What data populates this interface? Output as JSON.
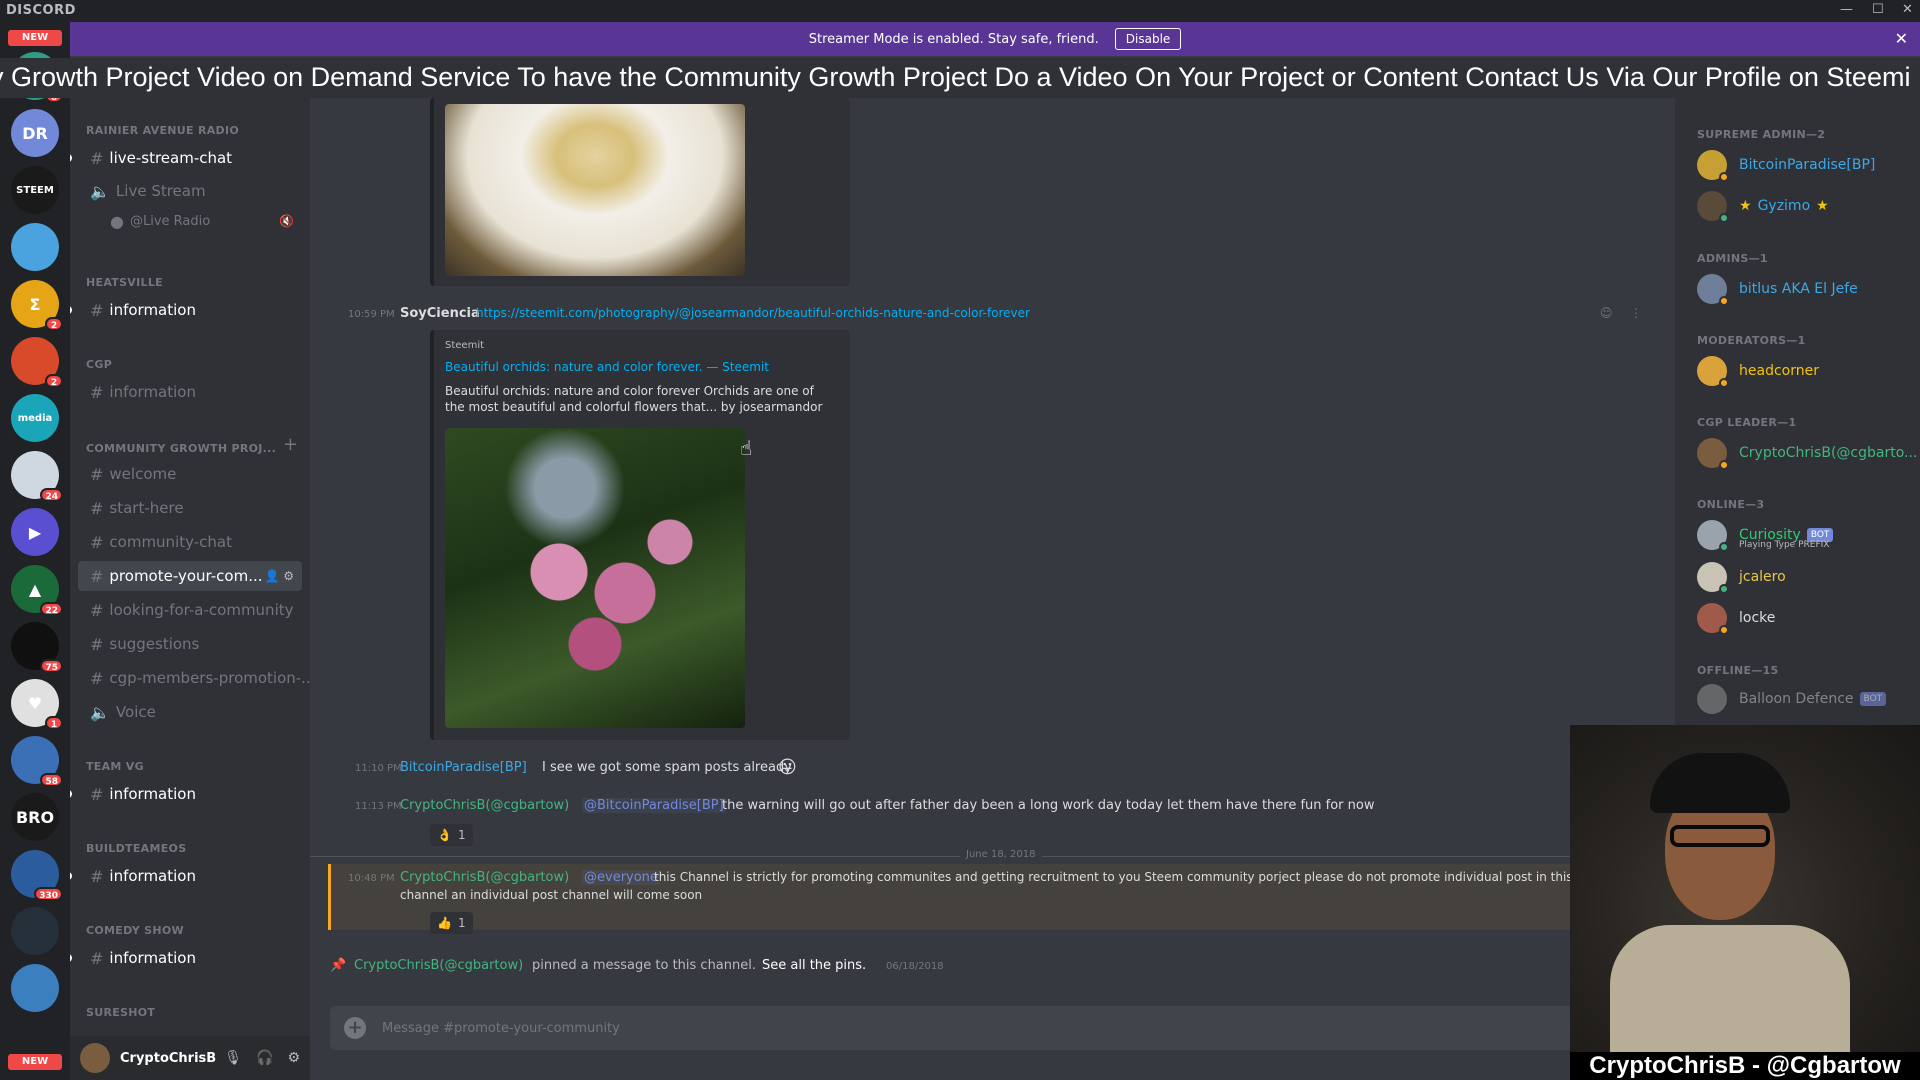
{
  "app": {
    "brand": "DISCORD"
  },
  "banner": {
    "text": "Streamer Mode is enabled. Stay safe, friend.",
    "button": "Disable"
  },
  "ticker": {
    "text": "y Growth Project Video on Demand Service To have the Community Growth Project Do a Video On Your Project or Content Contact Us Via Our Profile on Steemi"
  },
  "servers": {
    "new_top": "NEW",
    "new_bottom": "NEW",
    "items": [
      {
        "label": "",
        "color": "#2c9e84",
        "badge": "6"
      },
      {
        "label": "DR",
        "color": "#7289da",
        "badge": ""
      },
      {
        "label": "STEEM",
        "color": "#1a1a1a",
        "badge": ""
      },
      {
        "label": "",
        "color": "#4aa3df",
        "badge": ""
      },
      {
        "label": "Σ",
        "color": "#e6a417",
        "badge": "2"
      },
      {
        "label": "",
        "color": "#d84a2a",
        "badge": "2"
      },
      {
        "label": "media",
        "color": "#1aa5b8",
        "badge": ""
      },
      {
        "label": "",
        "color": "#cfd8e0",
        "badge": "24"
      },
      {
        "label": "▶",
        "color": "#5b4fd1",
        "badge": ""
      },
      {
        "label": "▲",
        "color": "#1b6b3a",
        "badge": "22"
      },
      {
        "label": "",
        "color": "#101010",
        "badge": "75"
      },
      {
        "label": "♥",
        "color": "#e0e0e0",
        "badge": "1"
      },
      {
        "label": "",
        "color": "#3b6fb6",
        "badge": "58"
      },
      {
        "label": "BRO",
        "color": "#1a1a1a",
        "badge": ""
      },
      {
        "label": "",
        "color": "#2b5d9e",
        "badge": "330"
      },
      {
        "label": "",
        "color": "#26303a",
        "badge": ""
      },
      {
        "label": "",
        "color": "#3b7fbf",
        "badge": ""
      }
    ]
  },
  "channels": {
    "categories": {
      "rainier": "RAINIER AVENUE RADIO",
      "heatsville": "HEATSVILLE",
      "cgp": "CGP",
      "cgp_project": "COMMUNITY GROWTH PROJ...",
      "team_vg": "TEAM VG",
      "buildteam": "BUILDTEAMEOS",
      "comedy": "COMEDY SHOW",
      "sureshot": "SURESHOT"
    },
    "live_stream_chat": "live-stream-chat",
    "live_stream_voice": "Live Stream",
    "live_radio_user": "@Live Radio",
    "heatsville_info": "information",
    "cgp_info": "information",
    "welcome": "welcome",
    "start_here": "start-here",
    "community_chat": "community-chat",
    "promote": "promote-your-com...",
    "looking": "looking-for-a-community",
    "suggestions": "suggestions",
    "cgp_members": "cgp-members-promotion-...",
    "voice": "Voice",
    "teamvg_info": "information",
    "buildteam_info": "information",
    "comedy_info": "information"
  },
  "user_panel": {
    "name": "CryptoChrisB"
  },
  "messages": {
    "m1": {
      "time": "10:59 PM",
      "author": "SoyCiencia",
      "link": "https://steemit.com/photography/@josearmandor/beautiful-orchids-nature-and-color-forever",
      "embed_provider": "Steemit",
      "embed_title": "Beautiful orchids: nature and color forever. — Steemit",
      "embed_desc_1": "Beautiful orchids: nature and color forever      Orchids are one of",
      "embed_desc_2": "the most beautiful and colorful flowers that... by josearmandor"
    },
    "m2": {
      "time": "11:10 PM",
      "author": "BitcoinParadise[BP]",
      "text": "I see we got some spam posts already",
      "emoji": "😛"
    },
    "m3": {
      "time": "11:13 PM",
      "author": "CryptoChrisB(@cgbartow)",
      "mention": "@BitcoinParadise[BP]",
      "text": "the warning will go out after father day been a long work day today let them have there fun for now",
      "reaction_emoji": "👌",
      "reaction_count": "1"
    },
    "date_divider": "June 18, 2018",
    "m4": {
      "time": "10:48 PM",
      "author": "CryptoChrisB(@cgbartow)",
      "mention": "@everyone",
      "text_1": "this Channel is strictly for promoting communites and getting recruitment to you Steem community porject please do not promote individual post in this",
      "text_2": "channel an individual post channel will come soon",
      "reaction_emoji": "👍",
      "reaction_count": "1"
    },
    "pin": {
      "author": "CryptoChrisB(@cgbartow)",
      "text": "pinned a message to this channel.",
      "link": "See all the pins.",
      "date": "06/18/2018"
    }
  },
  "input": {
    "placeholder": "Message #promote-your-community"
  },
  "members": {
    "supreme_admin": "SUPREME ADMIN—2",
    "admins": "ADMINS—1",
    "moderators": "MODERATORS—1",
    "cgp_leader": "CGP LEADER—1",
    "online": "ONLINE—3",
    "offline": "OFFLINE—15",
    "list": {
      "bitcoinparadise": "BitcoinParadise[BP]",
      "gyzimo": "Gyzimo",
      "bitlus": "bitlus AKA El Jefe",
      "headcorner": "headcorner",
      "cryptochrisb": "CryptoChrisB(@cgbarto...",
      "curiosity": "Curiosity",
      "curiosity_status": "Playing Type PREFIX",
      "jcalero": "jcalero",
      "locke": "locke",
      "balloon": "Balloon Defence",
      "bot_tag": "BOT"
    },
    "colors": {
      "supreme": "#3ba9e8",
      "admin": "#3ba9e8",
      "moderator": "#f1c40f",
      "leader": "#43b581",
      "online_bot": "#2ecc71",
      "online": "#e6c84a",
      "default": "#b9bbbe"
    }
  },
  "webcam": {
    "caption": "CryptoChrisB - @Cgbartow"
  }
}
